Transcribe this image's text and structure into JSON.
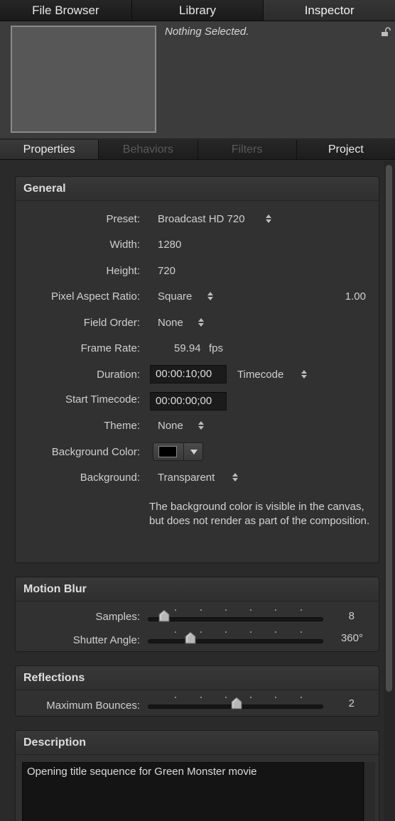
{
  "top_tabs": [
    "File Browser",
    "Library",
    "Inspector"
  ],
  "preview": {
    "status": "Nothing Selected."
  },
  "sub_tabs": [
    "Properties",
    "Behaviors",
    "Filters",
    "Project"
  ],
  "general": {
    "title": "General",
    "preset": {
      "label": "Preset:",
      "value": "Broadcast HD 720"
    },
    "width": {
      "label": "Width:",
      "value": "1280"
    },
    "height": {
      "label": "Height:",
      "value": "720"
    },
    "pixel_aspect": {
      "label": "Pixel Aspect Ratio:",
      "value": "Square",
      "ratio": "1.00"
    },
    "field_order": {
      "label": "Field Order:",
      "value": "None"
    },
    "frame_rate": {
      "label": "Frame Rate:",
      "value": "59.94",
      "unit": "fps"
    },
    "duration": {
      "label": "Duration:",
      "value": "00:00:10;00",
      "format": "Timecode"
    },
    "start_timecode": {
      "label": "Start Timecode:",
      "value": "00:00:00;00"
    },
    "theme": {
      "label": "Theme:",
      "value": "None"
    },
    "background_color": {
      "label": "Background Color:",
      "color": "#000000"
    },
    "background": {
      "label": "Background:",
      "value": "Transparent"
    },
    "note": "The background color is visible in the canvas, but does not render as part of the composition."
  },
  "motion_blur": {
    "title": "Motion Blur",
    "samples": {
      "label": "Samples:",
      "value": "8",
      "fraction": 0.06
    },
    "shutter_angle": {
      "label": "Shutter Angle:",
      "value": "360°",
      "fraction": 0.22
    }
  },
  "reflections": {
    "title": "Reflections",
    "max_bounces": {
      "label": "Maximum Bounces:",
      "value": "2",
      "fraction": 0.5
    }
  },
  "description": {
    "title": "Description",
    "text": "Opening title sequence for Green Monster movie"
  },
  "colors": {
    "panel": "#313131",
    "background": "#2a2a2a",
    "text": "#d0d0d0"
  }
}
